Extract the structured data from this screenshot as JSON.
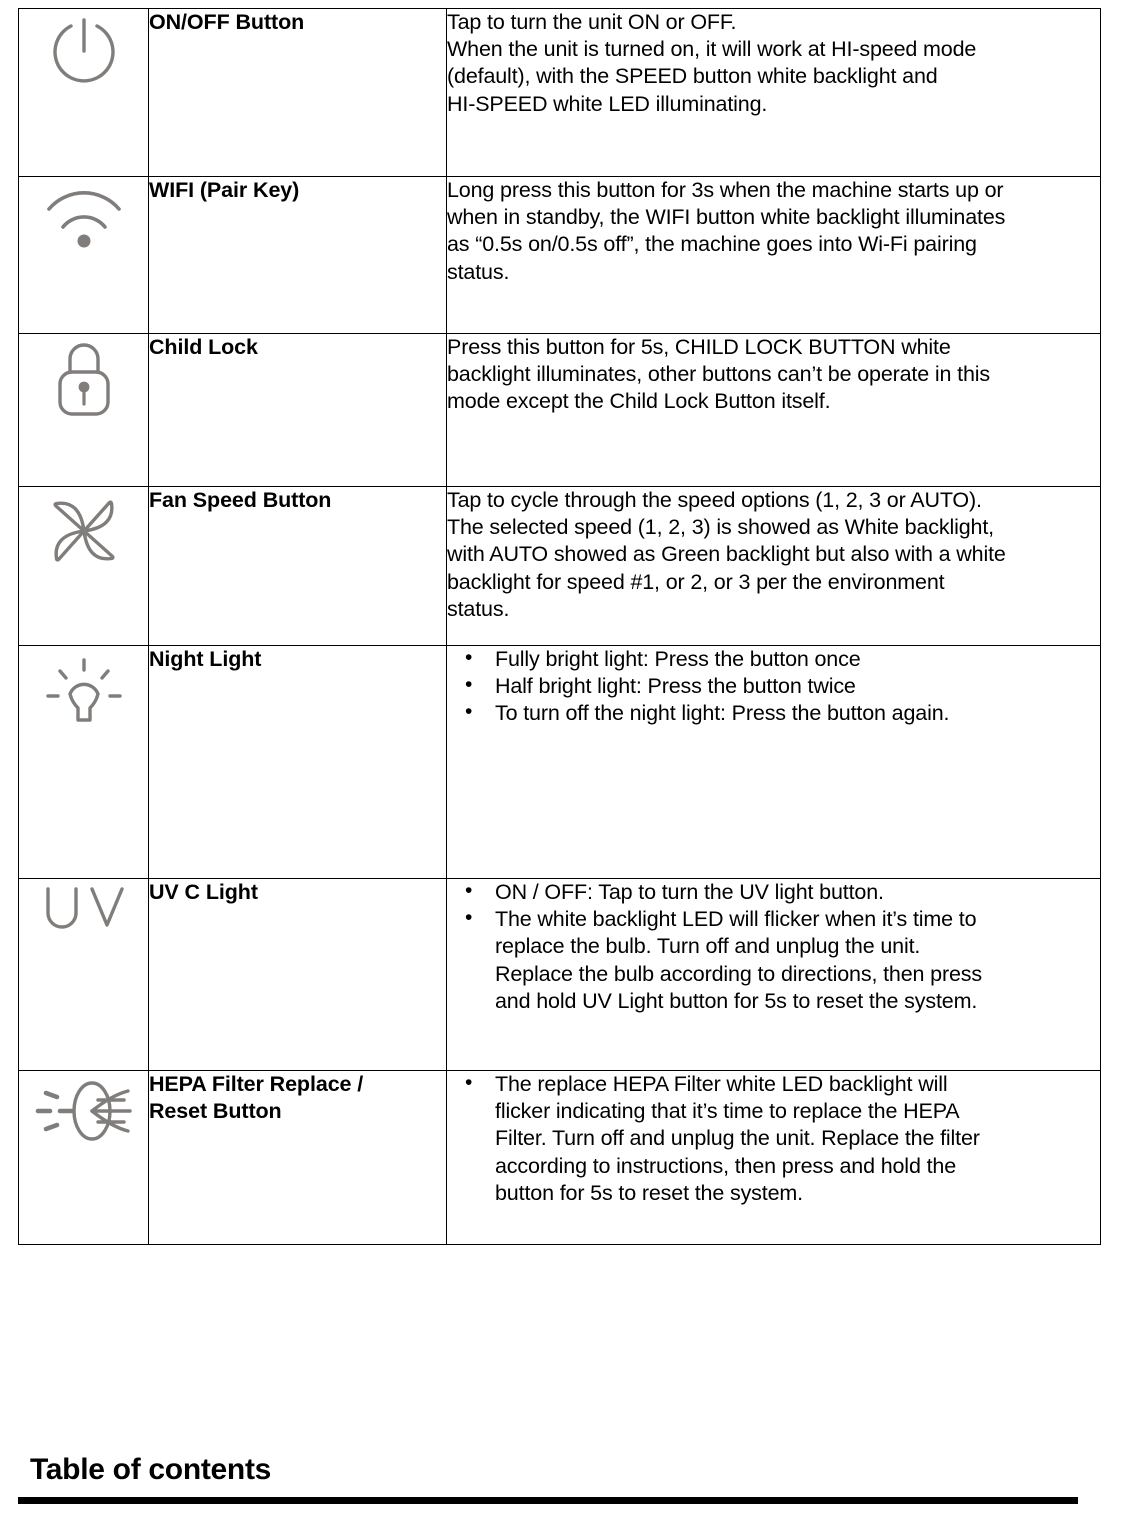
{
  "document": {
    "table": {
      "rows": [
        {
          "icon": "power-icon",
          "label": "ON/OFF Button",
          "description_lines": [
            "Tap to turn the unit ON or OFF.",
            "When the unit is turned on, it will work at HI-speed mode",
            "(default), with the SPEED button white backlight and",
            "HI-SPEED white LED illuminating."
          ],
          "bullets": []
        },
        {
          "icon": "wifi-icon",
          "label": "WIFI (Pair Key)",
          "description_lines": [
            "Long press this button for 3s when the machine starts up or",
            "when in standby, the WIFI button white backlight illuminates",
            "as “0.5s on/0.5s off”, the machine goes into Wi-Fi pairing",
            "status."
          ],
          "bullets": []
        },
        {
          "icon": "lock-icon",
          "label": "Child Lock",
          "description_lines": [
            "Press this button for 5s, CHILD LOCK BUTTON white",
            "backlight illuminates, other buttons can’t be operate in this",
            "mode except the Child Lock Button itself."
          ],
          "bullets": []
        },
        {
          "icon": "fan-icon",
          "label": "Fan Speed Button",
          "description_lines": [
            "Tap to cycle through the speed options (1, 2, 3 or AUTO).",
            "The selected speed (1, 2, 3) is showed as White backlight,",
            "with AUTO showed as Green backlight but also with a white",
            "backlight for speed #1, or 2, or 3 per the environment",
            "status."
          ],
          "bullets": []
        },
        {
          "icon": "night-light-icon",
          "label": "Night Light",
          "description_lines": [],
          "bullets": [
            [
              "Fully bright light: Press the button once"
            ],
            [
              "Half bright light: Press the button twice"
            ],
            [
              "To turn off the night light: Press the button again."
            ]
          ]
        },
        {
          "icon": "uv-icon",
          "label": "UV C Light",
          "description_lines": [],
          "bullets": [
            [
              "ON / OFF: Tap to turn the UV light button."
            ],
            [
              "The white backlight LED will flicker when it’s time to",
              "replace the bulb. Turn off and unplug the unit.",
              "Replace the bulb according to directions, then press",
              "and hold UV Light button for 5s to reset the system."
            ]
          ]
        },
        {
          "icon": "hepa-filter-icon",
          "label": "HEPA Filter Replace / Reset Button",
          "label_lines": [
            "HEPA Filter Replace /",
            "Reset Button"
          ],
          "description_lines": [],
          "bullets": [
            [
              "The replace HEPA Filter white LED backlight will",
              "flicker indicating that it’s time to replace the HEPA",
              "Filter. Turn off and unplug the unit. Replace the filter",
              "according to instructions, then press and hold the",
              "button for 5s to reset the system."
            ]
          ]
        }
      ],
      "bullet_glyph": "•"
    },
    "footer": {
      "heading": "Table of contents"
    },
    "colors": {
      "icon_gray": "#807d7b",
      "text": "#000000",
      "border": "#000000",
      "background": "#ffffff"
    }
  }
}
